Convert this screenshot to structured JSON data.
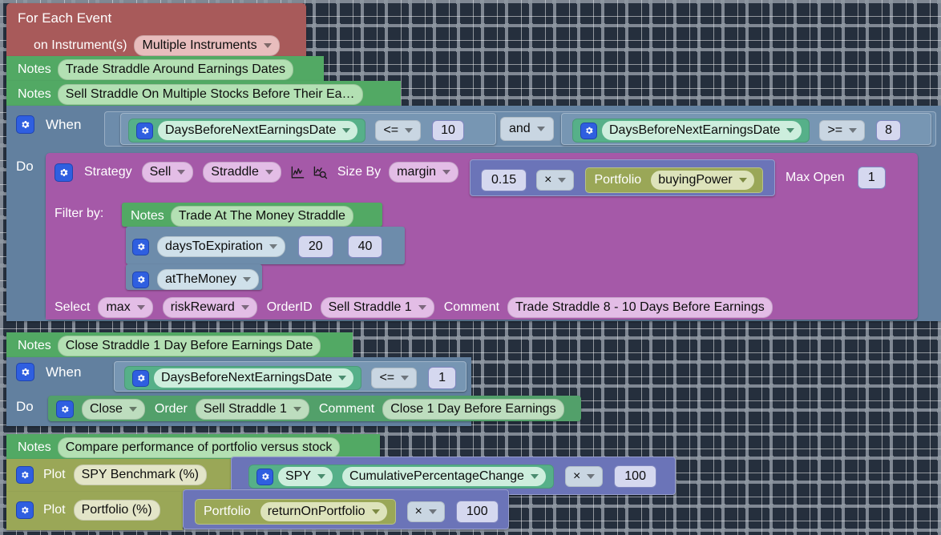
{
  "meta": {
    "app": "visual-strategy-block-editor",
    "canvas_background": "#252f3d",
    "colors": {
      "event_block": "#a85a5a",
      "notes_block": "#52a964",
      "when_block": "#62809f",
      "strategy_block": "#a559a8",
      "indicator_block": "#56b089",
      "math_block": "#6b74b8",
      "portfolio_block": "#9aa757",
      "close_block": "#52a06a",
      "plot_block": "#9aa757",
      "number_field": "#d5d8ef",
      "gear_icon": "#2f5fe0"
    }
  },
  "event_block": {
    "title": "For Each Event",
    "instrument_label": "on Instrument(s)",
    "instrument_value": "Multiple Instruments",
    "icon": "chevron-down-icon"
  },
  "notes": [
    {
      "label": "Notes",
      "value": "Trade Straddle Around Earnings Dates"
    },
    {
      "label": "Notes",
      "value": "Sell Straddle On Multiple Stocks Before Their Ea…"
    },
    {
      "label": "Notes",
      "value": "Trade At The Money Straddle"
    },
    {
      "label": "Notes",
      "value": "Close Straddle 1 Day Before Earnings Date"
    },
    {
      "label": "Notes",
      "value": "Compare performance of portfolio versus stock"
    }
  ],
  "when_entry": {
    "gear_icon": "gear-icon",
    "label": "When",
    "condition_a": {
      "gear_icon": "gear-icon",
      "indicator": "DaysBeforeNextEarningsDate",
      "operator": "<=",
      "value": "10"
    },
    "logic_operator": "and",
    "condition_b": {
      "gear_icon": "gear-icon",
      "indicator": "DaysBeforeNextEarningsDate",
      "operator": ">=",
      "value": "8"
    }
  },
  "do_entry": {
    "label": "Do",
    "strategy": {
      "gear_icon": "gear-icon",
      "label": "Strategy",
      "action": "Sell",
      "type": "Straddle",
      "chart_icon": "chart-icon",
      "analyze_icon": "chart-magnifier-icon",
      "size_by_label": "Size By",
      "size_by_value": "margin",
      "math": {
        "operand_a": "0.15",
        "operator": "×",
        "portfolio_label": "Portfolio",
        "portfolio_field": "buyingPower"
      },
      "max_open_label": "Max Open",
      "max_open_value": "1"
    },
    "filter_by_label": "Filter by:",
    "filters": [
      {
        "gear_icon": "gear-icon",
        "name": "daysToExpiration",
        "min": "20",
        "max": "40"
      },
      {
        "gear_icon": "gear-icon",
        "name": "atTheMoney"
      }
    ],
    "select_row": {
      "select_label": "Select",
      "aggregate": "max",
      "metric": "riskReward",
      "orderid_label": "OrderID",
      "orderid_value": "Sell Straddle 1",
      "comment_label": "Comment",
      "comment_value": "Trade Straddle 8 - 10 Days Before Earnings"
    }
  },
  "when_exit": {
    "gear_icon": "gear-icon",
    "label": "When",
    "condition": {
      "gear_icon": "gear-icon",
      "indicator": "DaysBeforeNextEarningsDate",
      "operator": "<=",
      "value": "1"
    }
  },
  "do_exit": {
    "label": "Do",
    "gear_icon": "gear-icon",
    "action": "Close",
    "order_label": "Order",
    "order_value": "Sell Straddle 1",
    "comment_label": "Comment",
    "comment_value": "Close 1 Day Before Earnings"
  },
  "plots": [
    {
      "gear_icon": "gear-icon",
      "label": "Plot",
      "name": "SPY Benchmark (%)",
      "source_gear_icon": "gear-icon",
      "symbol": "SPY",
      "field": "CumulativePercentageChange",
      "operator": "×",
      "multiplier": "100"
    },
    {
      "gear_icon": "gear-icon",
      "label": "Plot",
      "name": "Portfolio (%)",
      "portfolio_label": "Portfolio",
      "field": "returnOnPortfolio",
      "operator": "×",
      "multiplier": "100"
    }
  ]
}
